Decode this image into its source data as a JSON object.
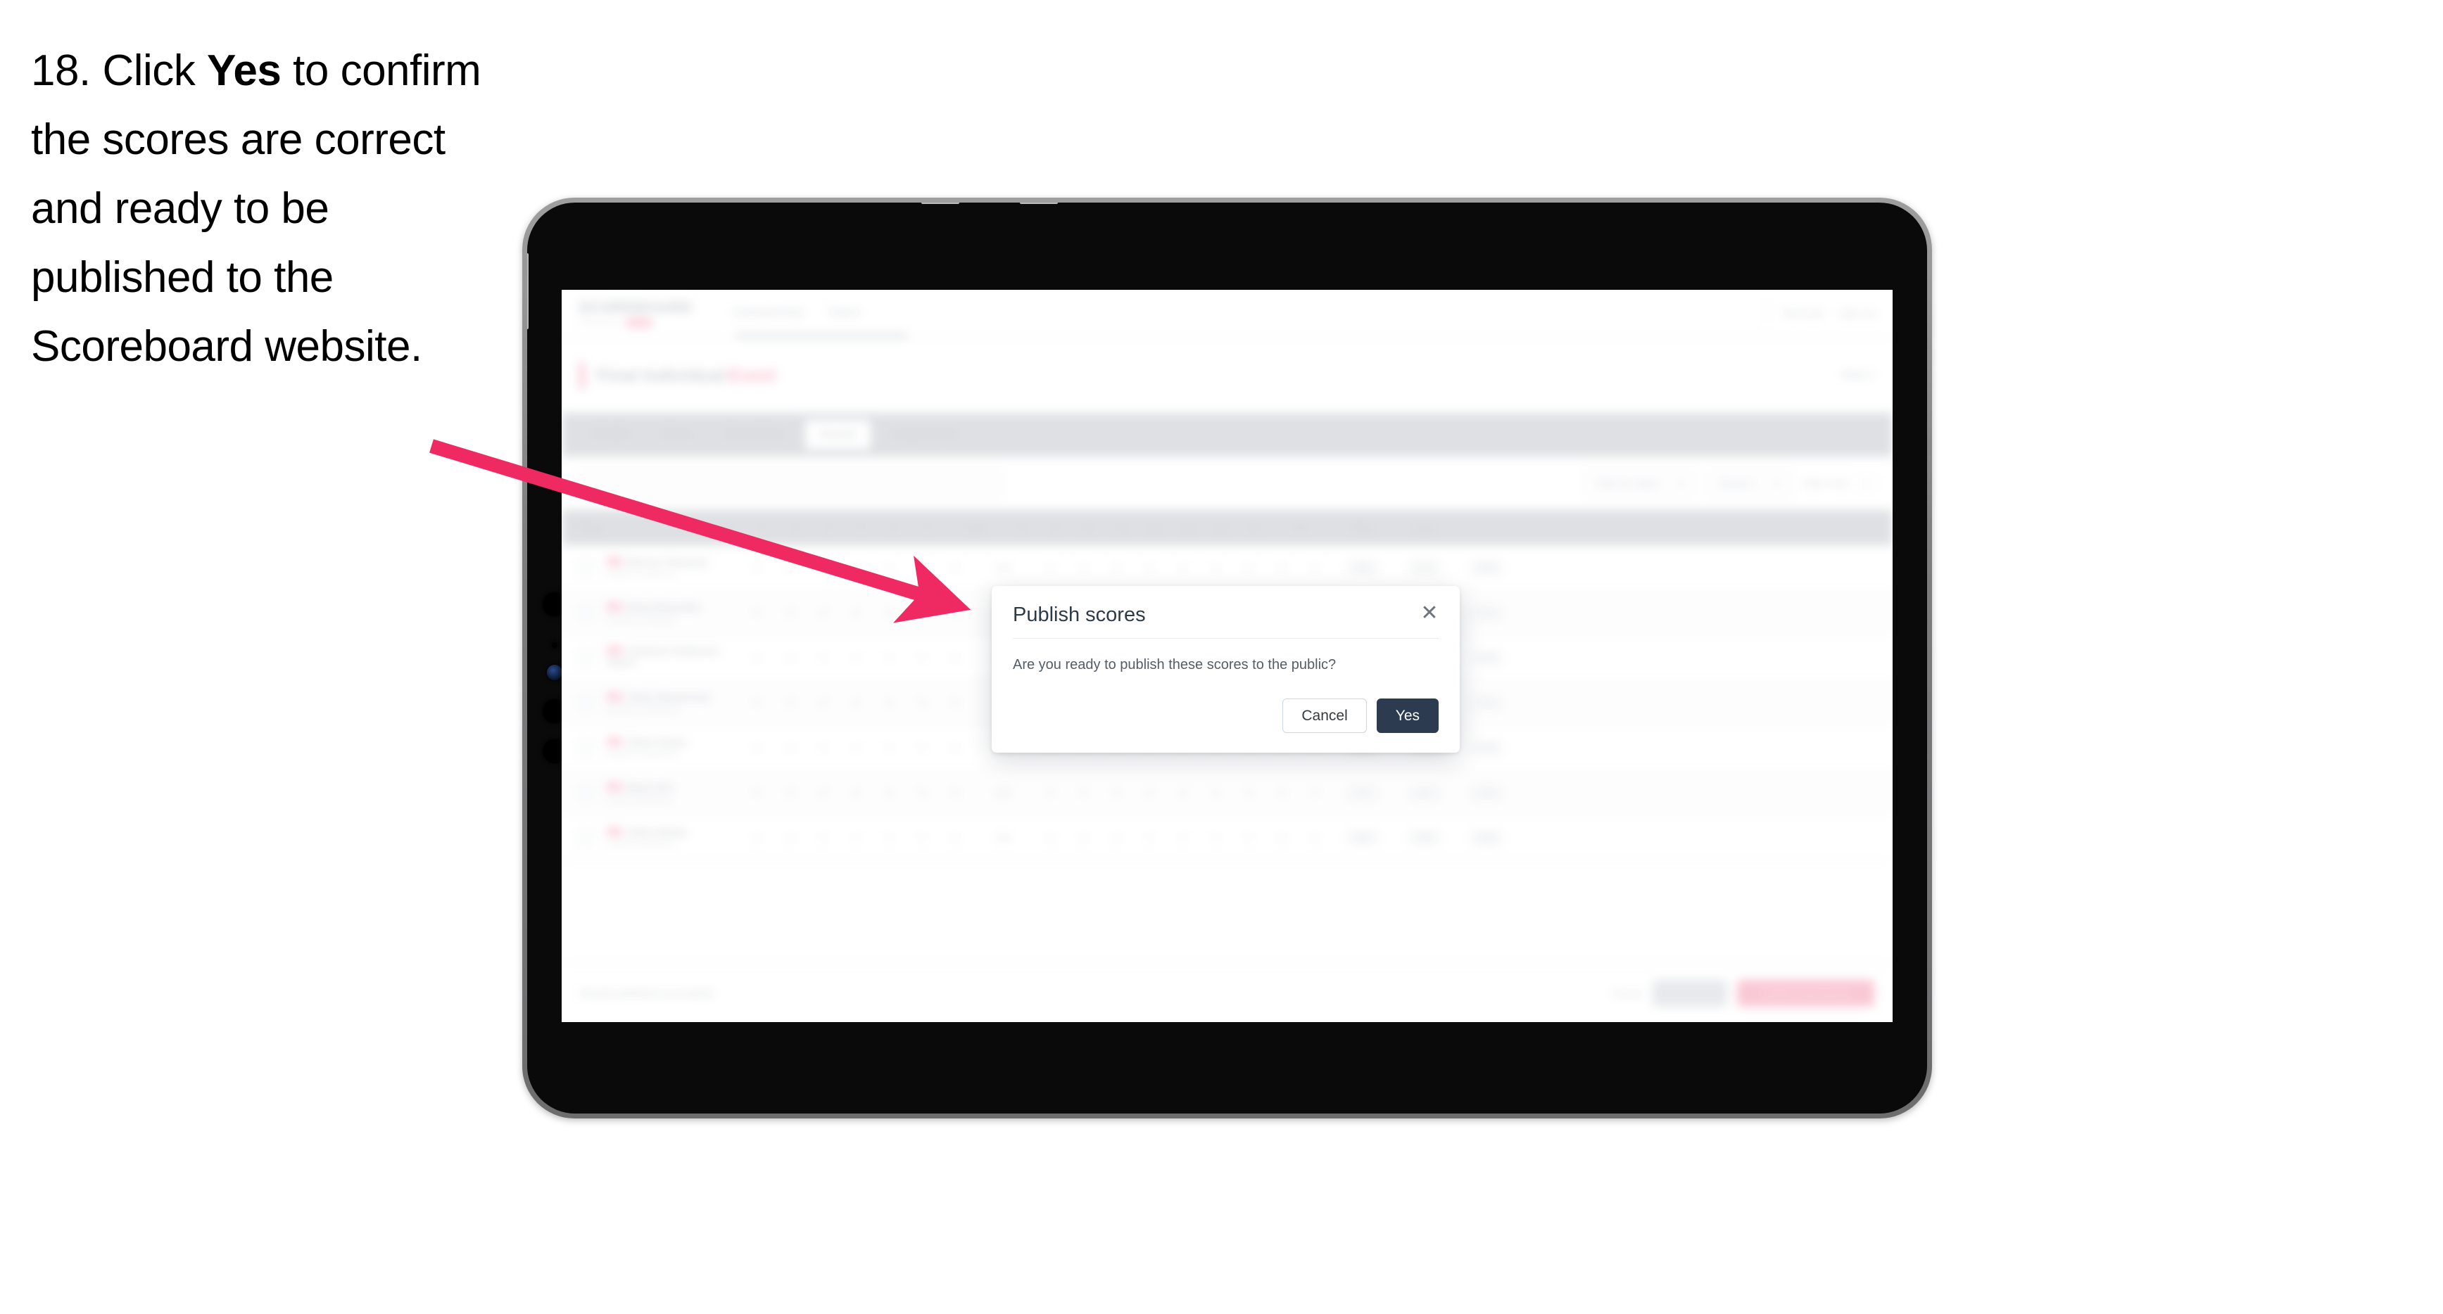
{
  "instruction": {
    "number": "18.",
    "pre": "Click ",
    "emphasis": "Yes",
    "post": " to confirm the scores are correct and ready to be published to the Scoreboard website."
  },
  "annotation": {
    "arrow_color": "#ef2a63",
    "arrow_from": "613,634",
    "arrow_to": "1383,868"
  },
  "device": {
    "type": "tablet",
    "orientation": "landscape",
    "frame_color": "#7d7d7e",
    "bezel_color": "#0a0a0a"
  },
  "app": {
    "header": {
      "logo": "SCOREBOARD",
      "logo_sub": "POWERED BY",
      "logo_pill": "LIVE",
      "nav": [
        "Championship",
        "Teams"
      ],
      "right": [
        "Test User",
        "Sign out"
      ]
    },
    "title_band": {
      "title": "Final Individual",
      "tag": "Event",
      "right": "Heat 1"
    },
    "tabs": [
      {
        "label": "Details",
        "active": false
      },
      {
        "label": "Draw",
        "active": false
      },
      {
        "label": "Score Entry",
        "active": false
      },
      {
        "label": "Results",
        "active": true
      },
      {
        "label": "Leaderboard",
        "active": false
      }
    ],
    "filters": {
      "search_placeholder": "Search",
      "select_status": "Filter by status",
      "select_round": "Round 1",
      "display_ctl": "Table Only"
    },
    "table": {
      "columns": [
        "Player",
        "1",
        "2",
        "3",
        "4",
        "5",
        "6",
        "7",
        "Total",
        "8",
        "9",
        "10",
        "11",
        "12",
        "13",
        "14",
        "15",
        "Pts",
        "Place",
        "Score"
      ],
      "rows": [
        {
          "name": "Marcus Thomson",
          "team": "Eastern Conference",
          "cells": [
            "0",
            "0",
            "0",
            "0",
            "0",
            "0",
            "0",
            "0",
            "0",
            "0",
            "0",
            "0",
            "0",
            "0",
            "0",
            "0",
            "0"
          ],
          "pts": "86",
          "place": "1st",
          "score": "240",
          "total": "120"
        },
        {
          "name": "Elena Reynolds",
          "team": "Southern Challenge",
          "cells": [
            "0",
            "0",
            "0",
            "0",
            "0",
            "0",
            "0",
            "0",
            "0",
            "0",
            "0",
            "0",
            "0",
            "0",
            "0",
            "0",
            "0"
          ],
          "pts": "85",
          "place": "2nd",
          "score": "238",
          "total": "118"
        },
        {
          "name": "Cameron Anderson-Hayes",
          "team": "",
          "cells": [
            "0",
            "0",
            "0",
            "0",
            "0",
            "0",
            "0",
            "0",
            "0",
            "0",
            "0",
            "0",
            "0",
            "0",
            "0",
            "0",
            "0"
          ],
          "pts": "84",
          "place": "3rd",
          "score": "236",
          "total": "116"
        },
        {
          "name": "Chloe Westerman",
          "team": "Northern Conference",
          "cells": [
            "0",
            "0",
            "0",
            "0",
            "0",
            "0",
            "0",
            "0",
            "0",
            "0",
            "0",
            "0",
            "0",
            "0",
            "0",
            "0",
            "0"
          ],
          "pts": "83",
          "place": "4th",
          "score": "234",
          "total": "114"
        },
        {
          "name": "Oliver Stuart",
          "team": "Western Conference",
          "cells": [
            "0",
            "0",
            "0",
            "0",
            "0",
            "0",
            "0",
            "0",
            "0",
            "0",
            "0",
            "0",
            "0",
            "0",
            "0",
            "0",
            "0"
          ],
          "pts": "82",
          "place": "5th",
          "score": "232",
          "total": "112"
        },
        {
          "name": "Ryan Kim",
          "team": "Pacific Conference",
          "cells": [
            "0",
            "0",
            "0",
            "0",
            "0",
            "0",
            "0",
            "0",
            "0",
            "0",
            "0",
            "0",
            "0",
            "0",
            "0",
            "0",
            "0"
          ],
          "pts": "81",
          "place": "6th",
          "score": "230",
          "total": "110"
        },
        {
          "name": "Aiden Bailey",
          "team": "Central Conference",
          "cells": [
            "0",
            "0",
            "0",
            "0",
            "0",
            "0",
            "0",
            "0",
            "0",
            "0",
            "0",
            "0",
            "0",
            "0",
            "0",
            "0",
            "0"
          ],
          "pts": "80",
          "place": "7th",
          "score": "228",
          "total": "108"
        }
      ]
    },
    "footer": {
      "note": "Results published successfully",
      "link": "Cancel",
      "secondary_button": "Save All",
      "primary_button": "Publish Final Results"
    }
  },
  "modal": {
    "title": "Publish scores",
    "close_icon": "close-icon",
    "body": "Are you ready to publish these scores to the public?",
    "cancel_label": "Cancel",
    "confirm_label": "Yes",
    "confirm_color": "#2d3b50"
  }
}
